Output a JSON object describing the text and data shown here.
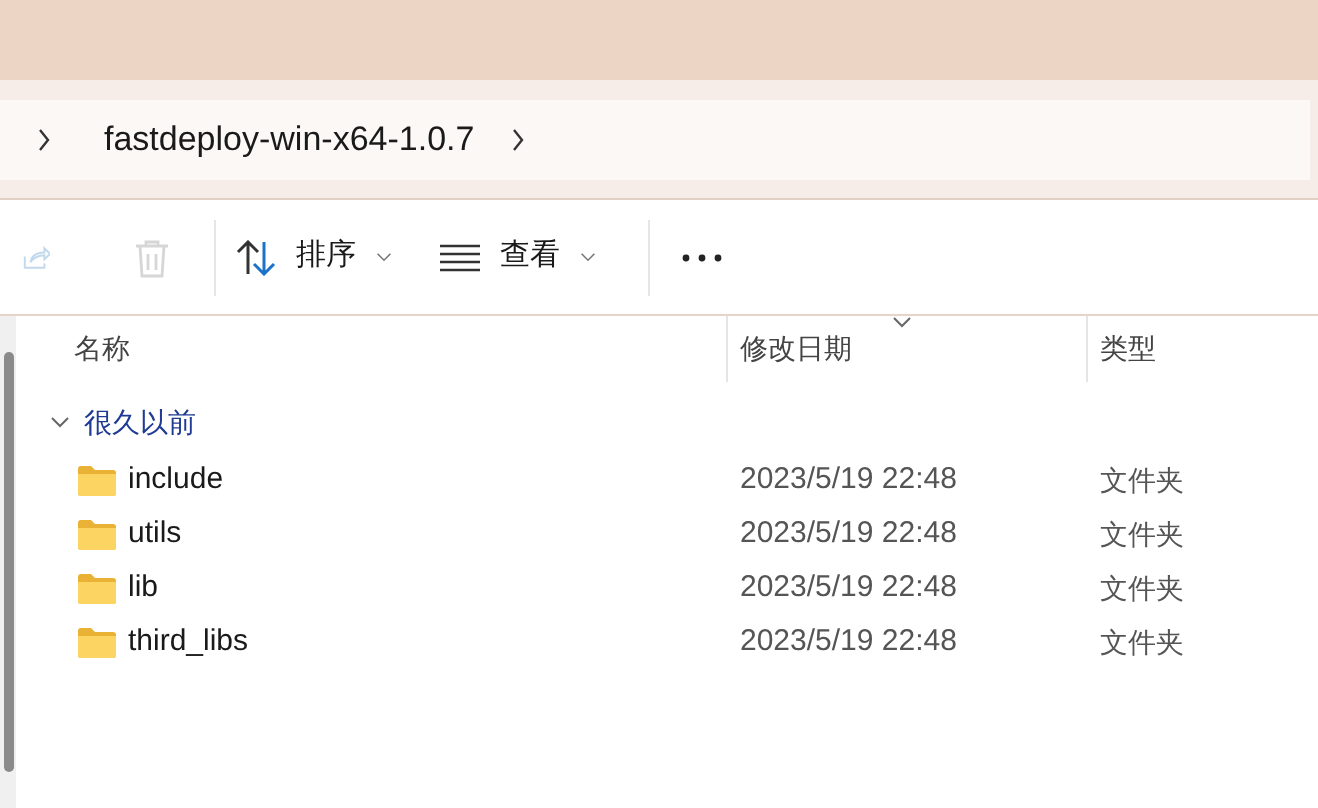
{
  "breadcrumb": {
    "items": [
      "fastdeploy-win-x64-1.0.7"
    ]
  },
  "toolbar": [
    {
      "kind": "share",
      "disabled": true
    },
    {
      "kind": "delete",
      "disabled": true
    },
    {
      "kind": "sort",
      "label": "排序",
      "disabled": false
    },
    {
      "kind": "view",
      "label": "查看",
      "disabled": false
    },
    {
      "kind": "more",
      "disabled": false
    }
  ],
  "table": {
    "columns": [
      {
        "label": "名称",
        "sorted": false
      },
      {
        "label": "修改日期",
        "sorted": true
      },
      {
        "label": "类型",
        "sorted": false
      }
    ],
    "groups": [
      {
        "label": "很久以前",
        "expanded": true,
        "rows": [
          {
            "name": "include",
            "modified": "2023/5/19 22:48",
            "type": "文件夹"
          },
          {
            "name": "utils",
            "modified": "2023/5/19 22:48",
            "type": "文件夹"
          },
          {
            "name": "lib",
            "modified": "2023/5/19 22:48",
            "type": "文件夹"
          },
          {
            "name": "third_libs",
            "modified": "2023/5/19 22:48",
            "type": "文件夹"
          }
        ]
      }
    ]
  }
}
